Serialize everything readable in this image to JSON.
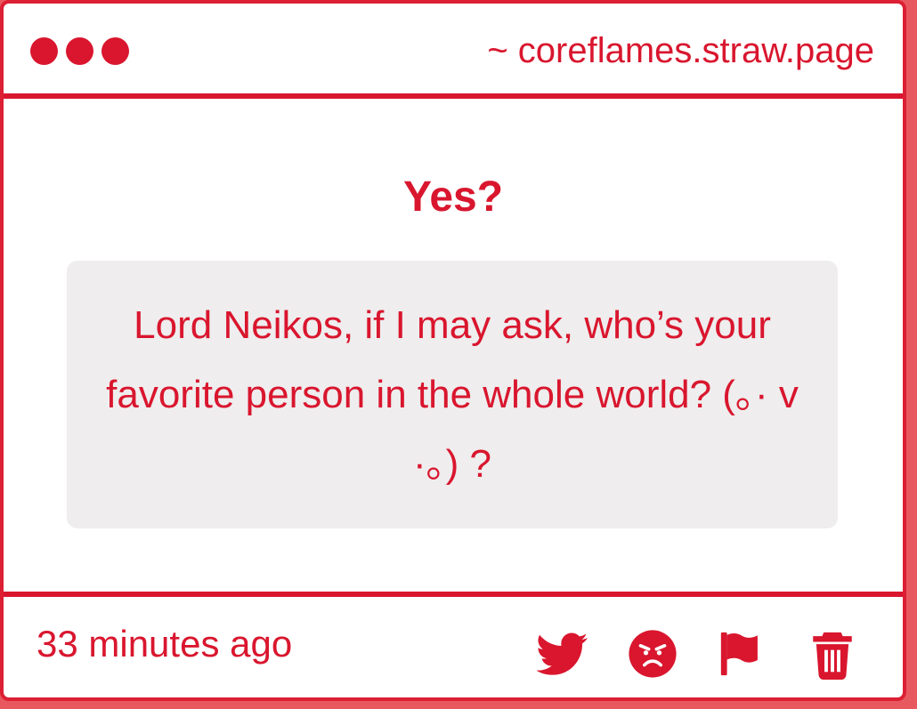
{
  "header": {
    "site": "~ coreflames.straw.page"
  },
  "post": {
    "title": "Yes?",
    "question": "Lord Neikos, if I may ask, who’s your favorite person in the whole world? (｡· v ·｡) ?"
  },
  "footer": {
    "timestamp": "33 minutes ago",
    "actions": [
      {
        "icon": "twitter-icon"
      },
      {
        "icon": "angry-face-icon"
      },
      {
        "icon": "flag-icon"
      },
      {
        "icon": "trash-icon"
      }
    ]
  },
  "colors": {
    "accent": "#d9162e",
    "question_bg": "#efedee",
    "page_bg": "#e8595f"
  }
}
